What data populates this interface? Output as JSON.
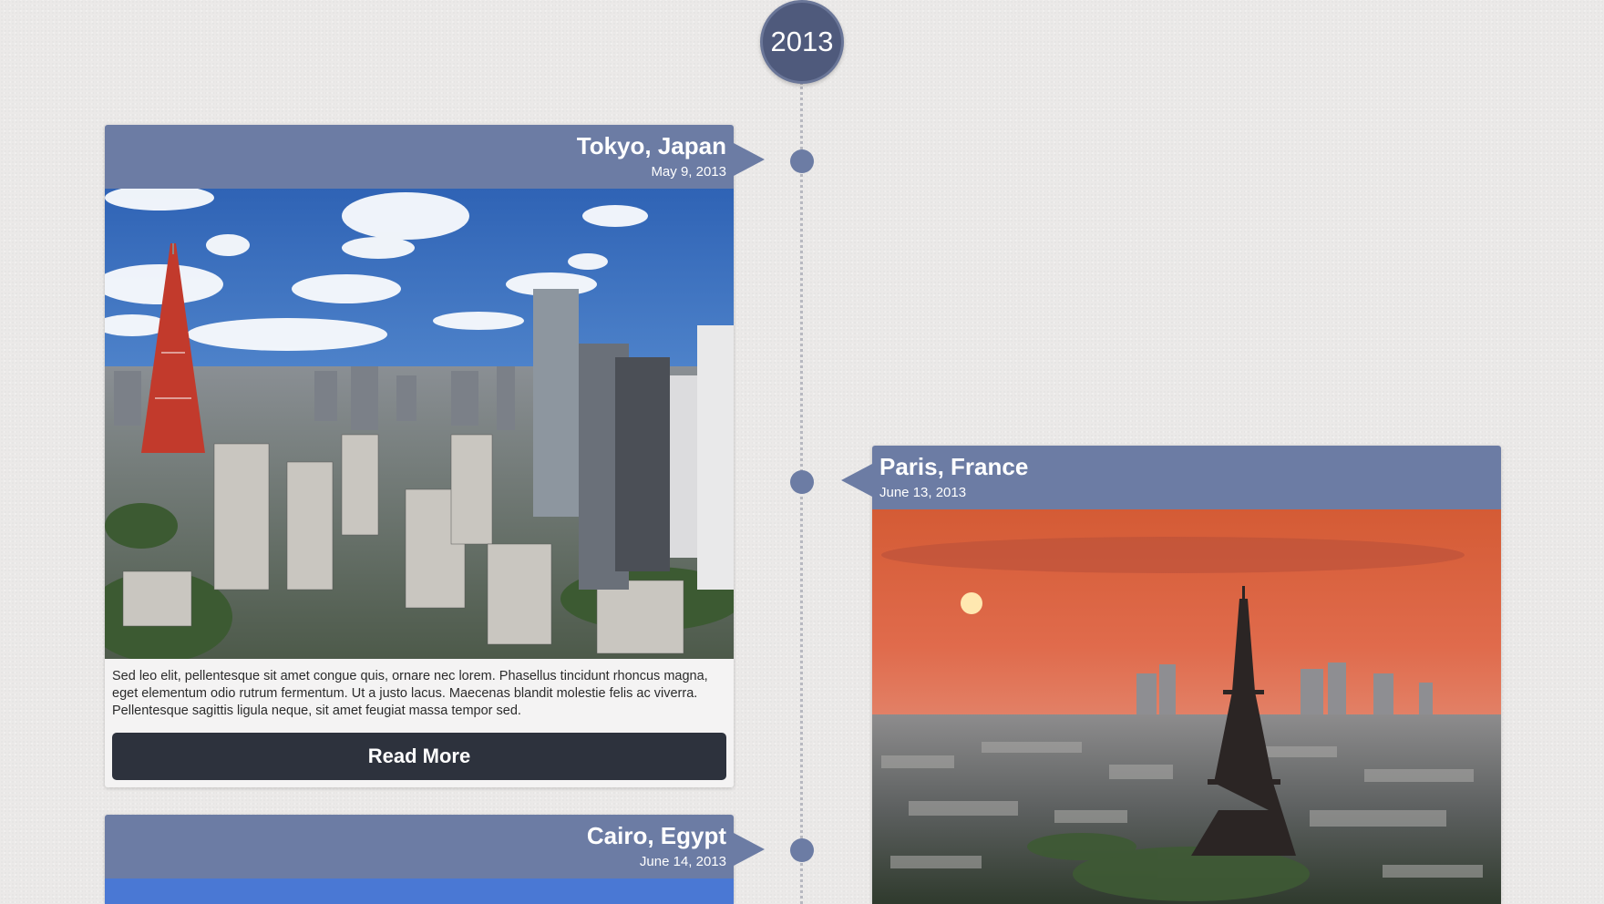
{
  "timeline": {
    "year": "2013",
    "events": [
      {
        "title": "Tokyo, Japan",
        "date": "May 9, 2013",
        "description": "Sed leo elit, pellentesque sit amet congue quis, ornare nec lorem. Phasellus tincidunt rhoncus magna, eget elementum odio rutrum fermentum. Ut a justo lacus. Maecenas blandit molestie felis ac viverra. Pellentesque sagittis ligula neque, sit amet feugiat massa tempor sed.",
        "button_label": "Read More"
      },
      {
        "title": "Paris, France",
        "date": "June 13, 2013"
      },
      {
        "title": "Cairo, Egypt",
        "date": "June 14, 2013"
      }
    ]
  },
  "colors": {
    "background": "#ebe9e8",
    "accent": "#6c7ca4",
    "year_badge": "#4f5a7c",
    "button": "#2d323d"
  }
}
